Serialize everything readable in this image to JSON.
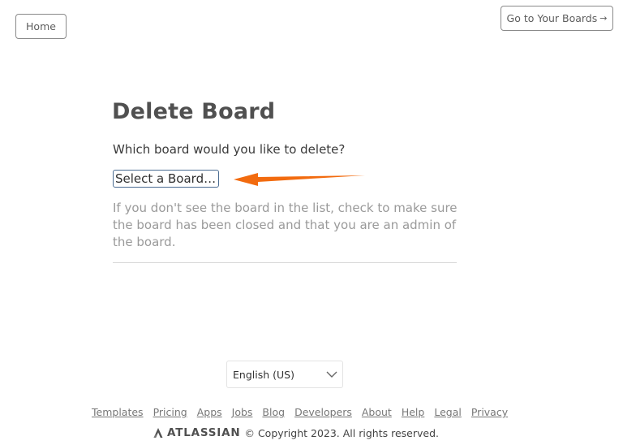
{
  "header": {
    "home_label": "Home",
    "boards_label": "Go to Your Boards",
    "boards_arrow": "→"
  },
  "main": {
    "title": "Delete Board",
    "question": "Which board would you like to delete?",
    "select": {
      "value": "Select a Board…",
      "icon": "chevron-down-icon"
    },
    "help_text": "If you don't see the board in the list, check to make sure the board has been closed and that you are an admin of the board."
  },
  "annotation": {
    "color": "#f26b0f"
  },
  "footer": {
    "language": "English (US)",
    "links": [
      "Templates",
      "Pricing",
      "Apps",
      "Jobs",
      "Blog",
      "Developers",
      "About",
      "Help",
      "Legal",
      "Privacy"
    ],
    "brand": "ATLASSIAN",
    "copyright": "© Copyright 2023. All rights reserved."
  }
}
